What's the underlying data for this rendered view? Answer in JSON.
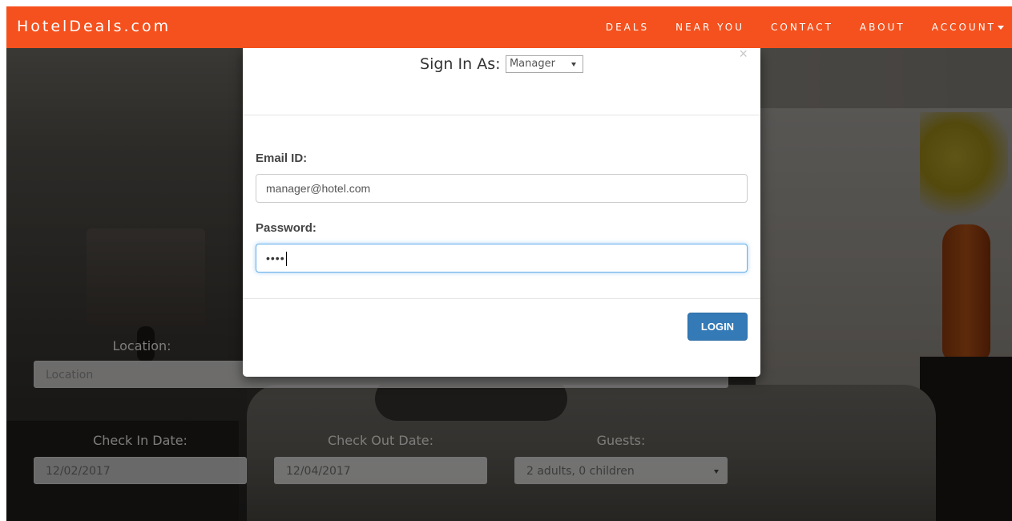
{
  "navbar": {
    "brand": "HotelDeals.com",
    "links": [
      "DEALS",
      "NEAR YOU",
      "CONTACT",
      "ABOUT",
      "ACCOUNT"
    ]
  },
  "search": {
    "location_label": "Location:",
    "location_placeholder": "Location",
    "checkin_label": "Check In Date:",
    "checkin_value": "12/02/2017",
    "checkout_label": "Check Out Date:",
    "checkout_value": "12/04/2017",
    "guests_label": "Guests:",
    "guests_value": "2 adults, 0 children"
  },
  "modal": {
    "close_symbol": "×",
    "sign_in_label": "Sign In As:",
    "role_value": "Manager",
    "email_label": "Email ID:",
    "email_value": "manager@hotel.com",
    "password_label": "Password:",
    "password_masked": "••••",
    "login_label": "LOGIN"
  },
  "colors": {
    "navbar": "#f4511e",
    "login_button": "#337ab7",
    "focus_border": "#66afe9"
  }
}
